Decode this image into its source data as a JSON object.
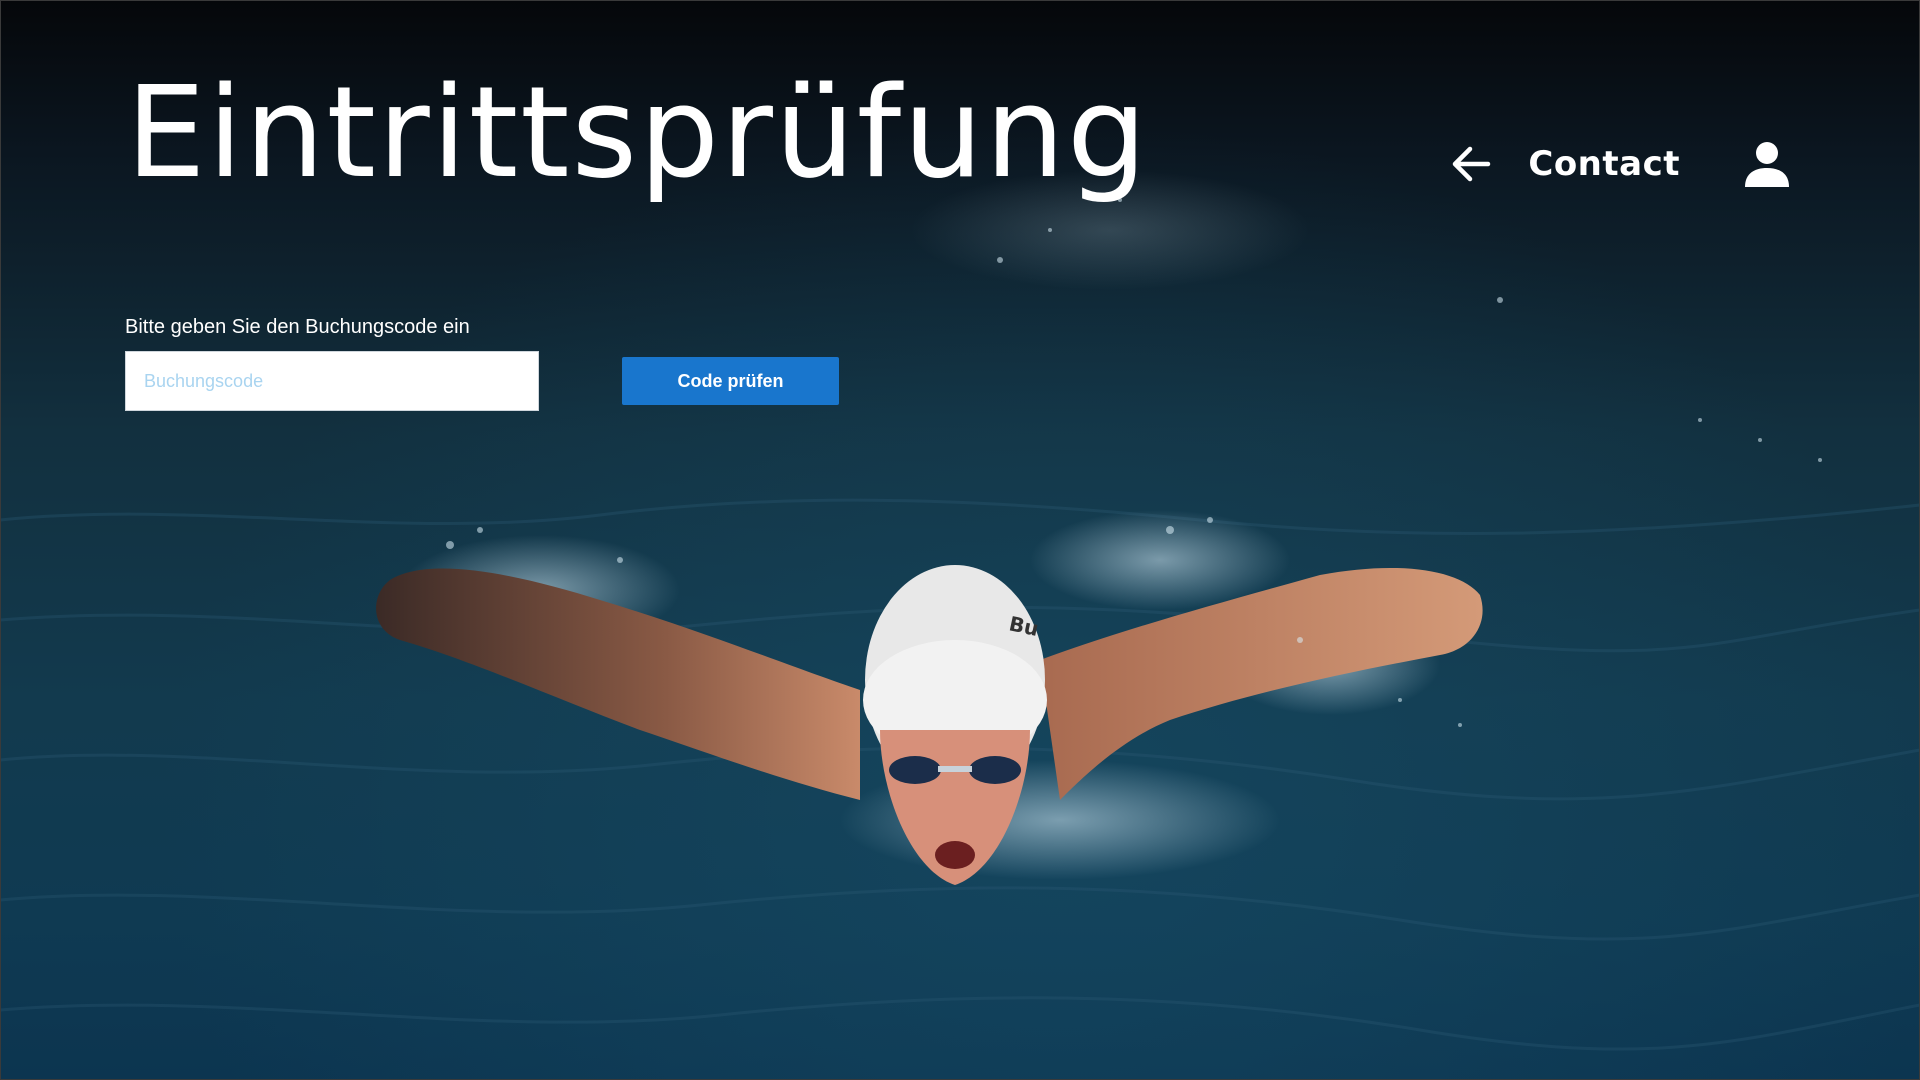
{
  "page": {
    "title": "Eintrittsprüfung"
  },
  "nav": {
    "back_icon": "arrow-left-icon",
    "contact_label": "Contact",
    "user_icon": "user-icon"
  },
  "form": {
    "label": "Bitte geben Sie den Buchungscode ein",
    "input_placeholder": "Buchungscode",
    "input_value": "",
    "button_label": "Code prüfen"
  },
  "background": {
    "description_icon": "swimmer-photo",
    "cap_text": "Bu"
  },
  "colors": {
    "button": "#1976cd",
    "placeholder": "#a9d4f0",
    "text": "#ffffff"
  }
}
